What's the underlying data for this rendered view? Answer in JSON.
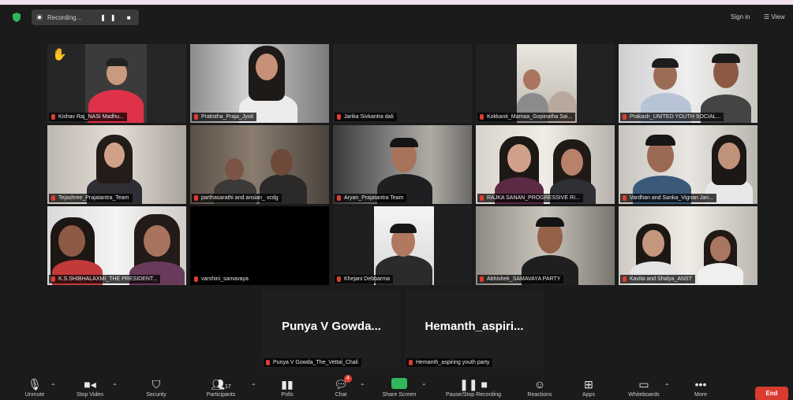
{
  "topbar": {
    "recording_label": "Recording...",
    "recording_controls": "❚❚ ■",
    "sign_in": "Sign in",
    "view": "View"
  },
  "tiles": [
    {
      "name": "Kishav Raj_NASI Madhu...",
      "raised_hand": true
    },
    {
      "name": "Pratistha_Praja_Jyoti"
    },
    {
      "name": "Jarika Sivkantra dali"
    },
    {
      "name": "Kokkanti_Mamaa_Gopinatha Sai..."
    },
    {
      "name": "Prakash_UNITED YOUTH SOCIAL..."
    },
    {
      "name": "Tejashree_Prajatantra_Team"
    },
    {
      "name": "parthasarathi and ansian_ vcdg"
    },
    {
      "name": "Aryan_Prajatantra Team",
      "active": true
    },
    {
      "name": "RAJKA SANAN_PROGRESSIVE RI..."
    },
    {
      "name": "Vardhan and Sanka_Vignan Jan..."
    },
    {
      "name": "K.S.SHIBHALAXMI_THE PRESIDENT..."
    },
    {
      "name": "varshini_samavaya"
    },
    {
      "name": "Khejani Debbarma"
    },
    {
      "name": "Abhishek_SAMAVAYA PARTY"
    },
    {
      "name": "Kavita and Shalya_ANST"
    }
  ],
  "name_tiles": [
    {
      "display": "Punya V Gowda...",
      "name": "Punya V Gowda_The_Vettal_Chali"
    },
    {
      "display": "Hemanth_aspiri...",
      "name": "Hemanth_aspiring youth party"
    }
  ],
  "toolbar": {
    "items": [
      {
        "label": "Unmute",
        "icon": "microphone-muted-icon"
      },
      {
        "label": "Stop Video",
        "icon": "video-camera-icon"
      },
      {
        "label": "Security",
        "icon": "shield-icon"
      },
      {
        "label": "Participants",
        "icon": "participants-icon",
        "count": "17"
      },
      {
        "label": "Polls",
        "icon": "bar-chart-icon"
      },
      {
        "label": "Chat",
        "icon": "chat-icon",
        "badge": "4"
      },
      {
        "label": "Share Screen",
        "icon": "share-screen-icon"
      },
      {
        "label": "Pause/Stop Recording",
        "icon": "recording-icon"
      },
      {
        "label": "Reactions",
        "icon": "reactions-icon"
      },
      {
        "label": "Apps",
        "icon": "apps-icon"
      },
      {
        "label": "Whiteboards",
        "icon": "whiteboard-icon"
      },
      {
        "label": "More",
        "icon": "more-icon"
      }
    ],
    "end_label": "End"
  },
  "colors": {
    "background": "#1b1b1b",
    "active_speaker": "#b6e04a",
    "end_button": "#d93b30",
    "share_green": "#2fb85b",
    "muted_red": "#e03c31"
  }
}
